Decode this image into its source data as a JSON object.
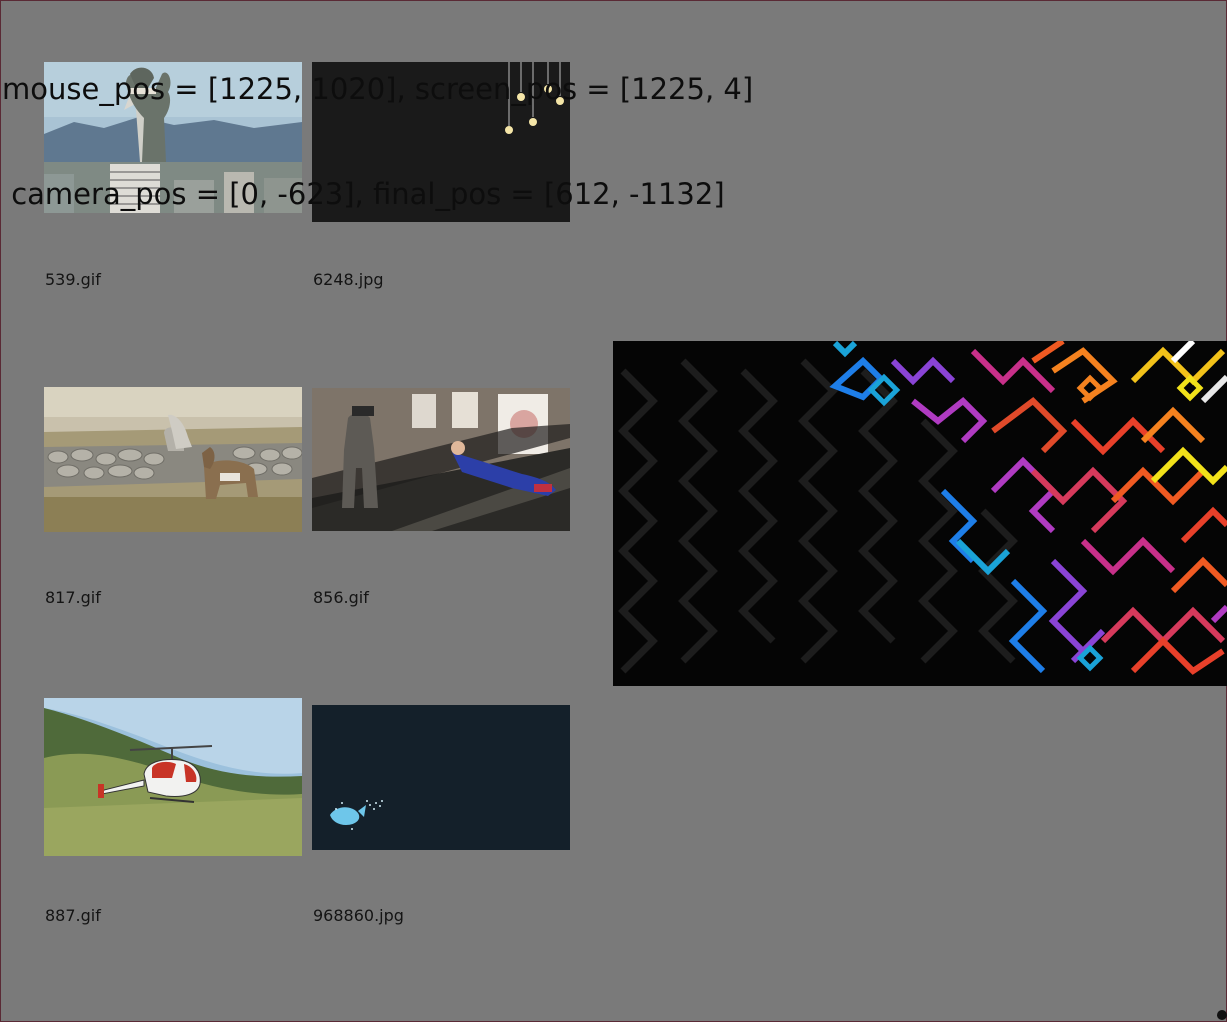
{
  "debug": {
    "line1": "mouse_pos = [1225, 1020], screen_pos = [1225, 4]",
    "line2": " camera_pos = [0, -623], final_pos = [612, -1132]"
  },
  "gallery": {
    "items": [
      {
        "filename": "539.gif",
        "icon": "kaiju-city-thumbnail"
      },
      {
        "filename": "6248.jpg",
        "icon": "light-bulbs-thumbnail"
      },
      {
        "filename": "817.gif",
        "icon": "ponies-wall-thumbnail"
      },
      {
        "filename": "856.gif",
        "icon": "escalator-thumbnail"
      },
      {
        "filename": "887.gif",
        "icon": "helicopter-thumbnail"
      },
      {
        "filename": "968860.jpg",
        "icon": "whale-thumbnail"
      }
    ]
  },
  "preview": {
    "icon": "maze-pattern-preview"
  },
  "colors": {
    "background": "#7a7a7a",
    "border": "#5a2a35"
  }
}
